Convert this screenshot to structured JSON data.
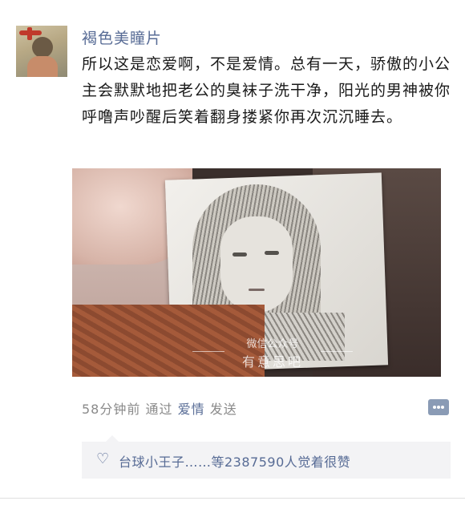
{
  "post": {
    "user_name": "褐色美瞳片",
    "text": "所以这是恋爱啊，不是爱情。总有一天，骄傲的小公主会默默地把老公的臭袜子洗干净，阳光的男神被你呼噜声吵醒后笑着翻身搂紧你再次沉沉睡去。",
    "image_watermark_line1": "微信公众号",
    "image_watermark_line2": "有意思吧",
    "time_ago": "58分钟前",
    "via_prefix": "通过",
    "via_tag": "爱情",
    "via_suffix": "发送",
    "likes_text": "台球小王子……等2387590人觉着很赞"
  },
  "icons": {
    "comment": "comment-dots-icon",
    "like": "heart-outline-icon"
  },
  "colors": {
    "link": "#576b95",
    "meta_text": "#8a8a8a",
    "likes_bg": "#f3f3f5"
  }
}
